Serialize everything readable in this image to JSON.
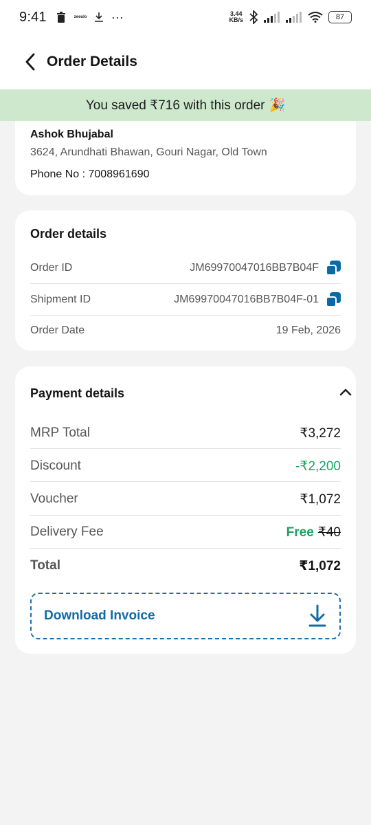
{
  "status_bar": {
    "time": "9:41",
    "speed_value": "3.44",
    "speed_unit": "KB/s",
    "battery": "87",
    "icons": [
      "trash-icon",
      "zeeulo-icon",
      "download-icon",
      "more-icon",
      "bluetooth-icon",
      "signal-icon",
      "signal-icon-2",
      "wifi-icon",
      "battery-icon"
    ],
    "small_app_label": "zeeulo"
  },
  "header": {
    "title": "Order Details"
  },
  "banner": {
    "text": "You saved ₹716 with this order",
    "emoji": "🎉"
  },
  "address": {
    "name": "Ashok Bhujabal",
    "line": "3624, Arundhati Bhawan, Gouri Nagar, Old Town",
    "phone": "Phone No : 7008961690"
  },
  "order_details": {
    "title": "Order details",
    "rows": [
      {
        "label": "Order ID",
        "value": "JM69970047016BB7B04F"
      },
      {
        "label": "Shipment ID",
        "value": "JM69970047016BB7B04F-01"
      },
      {
        "label": "Order Date",
        "value": "19 Feb, 2026"
      }
    ]
  },
  "payment_details": {
    "title": "Payment details",
    "rows": [
      {
        "label": "MRP Total",
        "value": "₹3,272"
      },
      {
        "label": "Discount",
        "value": "-₹2,200"
      },
      {
        "label": "Voucher",
        "value": "₹1,072"
      },
      {
        "label": "Delivery Fee",
        "value": "Free",
        "struck": "₹40"
      },
      {
        "label": "Total",
        "value": "₹1,072"
      }
    ],
    "download_label": "Download Invoice"
  },
  "colors": {
    "accent": "#0f6ba3",
    "green": "#1aa260",
    "banner_bg": "#cde8cd",
    "page_bg": "#f3f3f3"
  }
}
